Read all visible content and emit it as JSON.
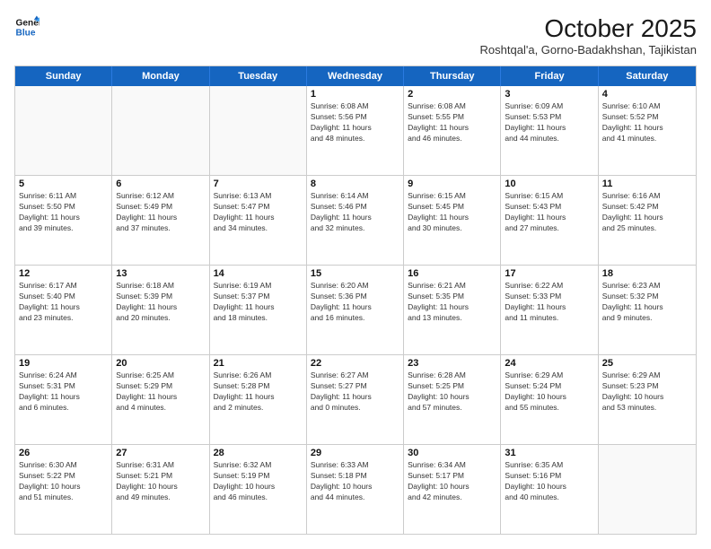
{
  "logo": {
    "line1": "General",
    "line2": "Blue"
  },
  "title": "October 2025",
  "subtitle": "Roshtqal'a, Gorno-Badakhshan, Tajikistan",
  "days_of_week": [
    "Sunday",
    "Monday",
    "Tuesday",
    "Wednesday",
    "Thursday",
    "Friday",
    "Saturday"
  ],
  "weeks": [
    [
      {
        "day": "",
        "content": ""
      },
      {
        "day": "",
        "content": ""
      },
      {
        "day": "",
        "content": ""
      },
      {
        "day": "1",
        "content": "Sunrise: 6:08 AM\nSunset: 5:56 PM\nDaylight: 11 hours\nand 48 minutes."
      },
      {
        "day": "2",
        "content": "Sunrise: 6:08 AM\nSunset: 5:55 PM\nDaylight: 11 hours\nand 46 minutes."
      },
      {
        "day": "3",
        "content": "Sunrise: 6:09 AM\nSunset: 5:53 PM\nDaylight: 11 hours\nand 44 minutes."
      },
      {
        "day": "4",
        "content": "Sunrise: 6:10 AM\nSunset: 5:52 PM\nDaylight: 11 hours\nand 41 minutes."
      }
    ],
    [
      {
        "day": "5",
        "content": "Sunrise: 6:11 AM\nSunset: 5:50 PM\nDaylight: 11 hours\nand 39 minutes."
      },
      {
        "day": "6",
        "content": "Sunrise: 6:12 AM\nSunset: 5:49 PM\nDaylight: 11 hours\nand 37 minutes."
      },
      {
        "day": "7",
        "content": "Sunrise: 6:13 AM\nSunset: 5:47 PM\nDaylight: 11 hours\nand 34 minutes."
      },
      {
        "day": "8",
        "content": "Sunrise: 6:14 AM\nSunset: 5:46 PM\nDaylight: 11 hours\nand 32 minutes."
      },
      {
        "day": "9",
        "content": "Sunrise: 6:15 AM\nSunset: 5:45 PM\nDaylight: 11 hours\nand 30 minutes."
      },
      {
        "day": "10",
        "content": "Sunrise: 6:15 AM\nSunset: 5:43 PM\nDaylight: 11 hours\nand 27 minutes."
      },
      {
        "day": "11",
        "content": "Sunrise: 6:16 AM\nSunset: 5:42 PM\nDaylight: 11 hours\nand 25 minutes."
      }
    ],
    [
      {
        "day": "12",
        "content": "Sunrise: 6:17 AM\nSunset: 5:40 PM\nDaylight: 11 hours\nand 23 minutes."
      },
      {
        "day": "13",
        "content": "Sunrise: 6:18 AM\nSunset: 5:39 PM\nDaylight: 11 hours\nand 20 minutes."
      },
      {
        "day": "14",
        "content": "Sunrise: 6:19 AM\nSunset: 5:37 PM\nDaylight: 11 hours\nand 18 minutes."
      },
      {
        "day": "15",
        "content": "Sunrise: 6:20 AM\nSunset: 5:36 PM\nDaylight: 11 hours\nand 16 minutes."
      },
      {
        "day": "16",
        "content": "Sunrise: 6:21 AM\nSunset: 5:35 PM\nDaylight: 11 hours\nand 13 minutes."
      },
      {
        "day": "17",
        "content": "Sunrise: 6:22 AM\nSunset: 5:33 PM\nDaylight: 11 hours\nand 11 minutes."
      },
      {
        "day": "18",
        "content": "Sunrise: 6:23 AM\nSunset: 5:32 PM\nDaylight: 11 hours\nand 9 minutes."
      }
    ],
    [
      {
        "day": "19",
        "content": "Sunrise: 6:24 AM\nSunset: 5:31 PM\nDaylight: 11 hours\nand 6 minutes."
      },
      {
        "day": "20",
        "content": "Sunrise: 6:25 AM\nSunset: 5:29 PM\nDaylight: 11 hours\nand 4 minutes."
      },
      {
        "day": "21",
        "content": "Sunrise: 6:26 AM\nSunset: 5:28 PM\nDaylight: 11 hours\nand 2 minutes."
      },
      {
        "day": "22",
        "content": "Sunrise: 6:27 AM\nSunset: 5:27 PM\nDaylight: 11 hours\nand 0 minutes."
      },
      {
        "day": "23",
        "content": "Sunrise: 6:28 AM\nSunset: 5:25 PM\nDaylight: 10 hours\nand 57 minutes."
      },
      {
        "day": "24",
        "content": "Sunrise: 6:29 AM\nSunset: 5:24 PM\nDaylight: 10 hours\nand 55 minutes."
      },
      {
        "day": "25",
        "content": "Sunrise: 6:29 AM\nSunset: 5:23 PM\nDaylight: 10 hours\nand 53 minutes."
      }
    ],
    [
      {
        "day": "26",
        "content": "Sunrise: 6:30 AM\nSunset: 5:22 PM\nDaylight: 10 hours\nand 51 minutes."
      },
      {
        "day": "27",
        "content": "Sunrise: 6:31 AM\nSunset: 5:21 PM\nDaylight: 10 hours\nand 49 minutes."
      },
      {
        "day": "28",
        "content": "Sunrise: 6:32 AM\nSunset: 5:19 PM\nDaylight: 10 hours\nand 46 minutes."
      },
      {
        "day": "29",
        "content": "Sunrise: 6:33 AM\nSunset: 5:18 PM\nDaylight: 10 hours\nand 44 minutes."
      },
      {
        "day": "30",
        "content": "Sunrise: 6:34 AM\nSunset: 5:17 PM\nDaylight: 10 hours\nand 42 minutes."
      },
      {
        "day": "31",
        "content": "Sunrise: 6:35 AM\nSunset: 5:16 PM\nDaylight: 10 hours\nand 40 minutes."
      },
      {
        "day": "",
        "content": ""
      }
    ]
  ]
}
